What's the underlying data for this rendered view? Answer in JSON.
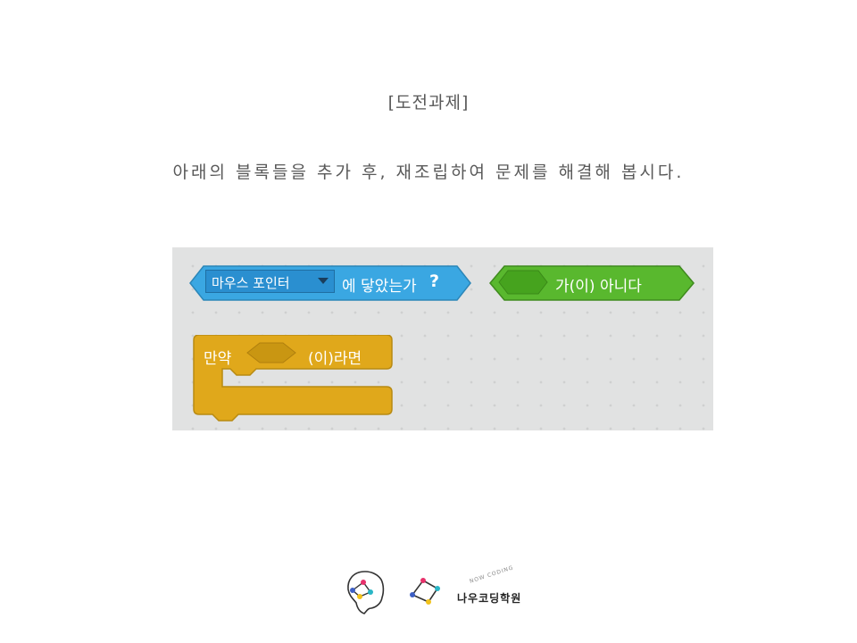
{
  "title": "[도전과제]",
  "instruction": "아래의 블록들을 추가 후, 재조립하여 문제를 해결해 봅시다.",
  "blocks": {
    "touching": {
      "dropdown_value": "마우스 포인터",
      "suffix": "에 닿았는가",
      "question_mark": "?",
      "color": "#3aa7e2"
    },
    "not_block": {
      "label": "가(이) 아니다",
      "color": "#59b82e"
    },
    "if_block": {
      "prefix": "만약",
      "suffix": "(이)라면",
      "color": "#e0a81b"
    }
  },
  "footer": {
    "brand_arc": "NOW CODING",
    "brand_name": "나우코딩학원"
  }
}
